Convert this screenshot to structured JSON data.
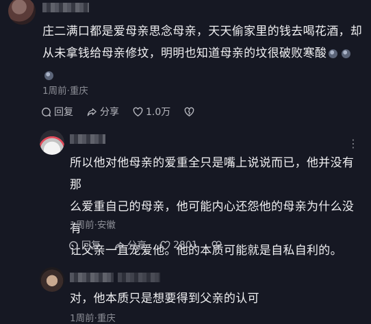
{
  "comments": [
    {
      "text_lines": [
        "庄二满口都是爱母亲思念母亲，天天偷家里的钱去喝花酒，却",
        "从未拿钱给母亲修坟，明明也知道母亲的坟很破败寒酸"
      ],
      "meta": "1周前·重庆",
      "reply_label": "回复",
      "share_label": "分享",
      "like_count": "1.0万"
    },
    {
      "text_lines": [
        "所以他对他母亲的爱重全只是嘴上说说而已，他并没有那",
        "么爱重自己的母亲，他可能内心还怨他的母亲为什么没有",
        "让父亲一直宠爱他。他的本质可能就是自私自利的。"
      ],
      "meta": "1周前·安徽",
      "reply_label": "回复",
      "share_label": "分享",
      "like_count": "2801"
    },
    {
      "text_lines": [
        "对，他本质只是想要得到父亲的认可"
      ],
      "meta": "1周前·重庆"
    }
  ],
  "icons": {
    "reply": "reply-bubble-icon",
    "share": "share-arrow-icon",
    "like": "heart-icon",
    "dislike": "broken-heart-icon",
    "more": "more-dots-icon",
    "emoji": "sticker-emoji-icon"
  }
}
